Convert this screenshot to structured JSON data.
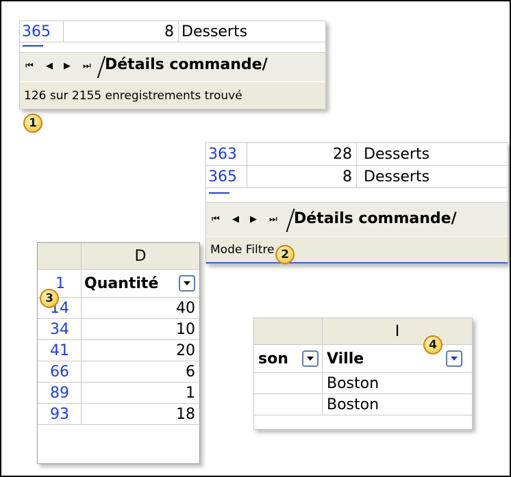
{
  "panel1": {
    "row_top": {
      "rownum": "365",
      "quantity": "8",
      "category": "Desserts"
    },
    "nav": {
      "first": "◀",
      "prev": "◀",
      "next": "▶",
      "last": "▶"
    },
    "tab_label": "Détails commande",
    "status": "126 sur 2155 enregistrements trouvé",
    "badge": "1"
  },
  "panel2": {
    "rows": [
      {
        "rownum": "363",
        "quantity": "28",
        "category": "Desserts"
      },
      {
        "rownum": "365",
        "quantity": "8",
        "category": "Desserts"
      }
    ],
    "tab_label": "Détails commande",
    "status": "Mode Filtre",
    "badge": "2"
  },
  "panel3": {
    "column_letter": "D",
    "header_rownum": "1",
    "header_label": "Quantité",
    "badge": "3",
    "rows": [
      {
        "rownum": "14",
        "value": "40"
      },
      {
        "rownum": "34",
        "value": "10"
      },
      {
        "rownum": "41",
        "value": "20"
      },
      {
        "rownum": "66",
        "value": "6"
      },
      {
        "rownum": "89",
        "value": "1"
      },
      {
        "rownum": "93",
        "value": "18"
      }
    ]
  },
  "panel4": {
    "column_letter": "I",
    "prev_header_fragment": "son",
    "header_label": "Ville",
    "badge": "4",
    "rows": [
      "Boston",
      "Boston"
    ]
  },
  "colors": {
    "rownum_blue": "#1f3fcf",
    "status_bg": "#eceadb",
    "badge": "#f7cf55",
    "filter_arrow_active": "#2238d8"
  }
}
